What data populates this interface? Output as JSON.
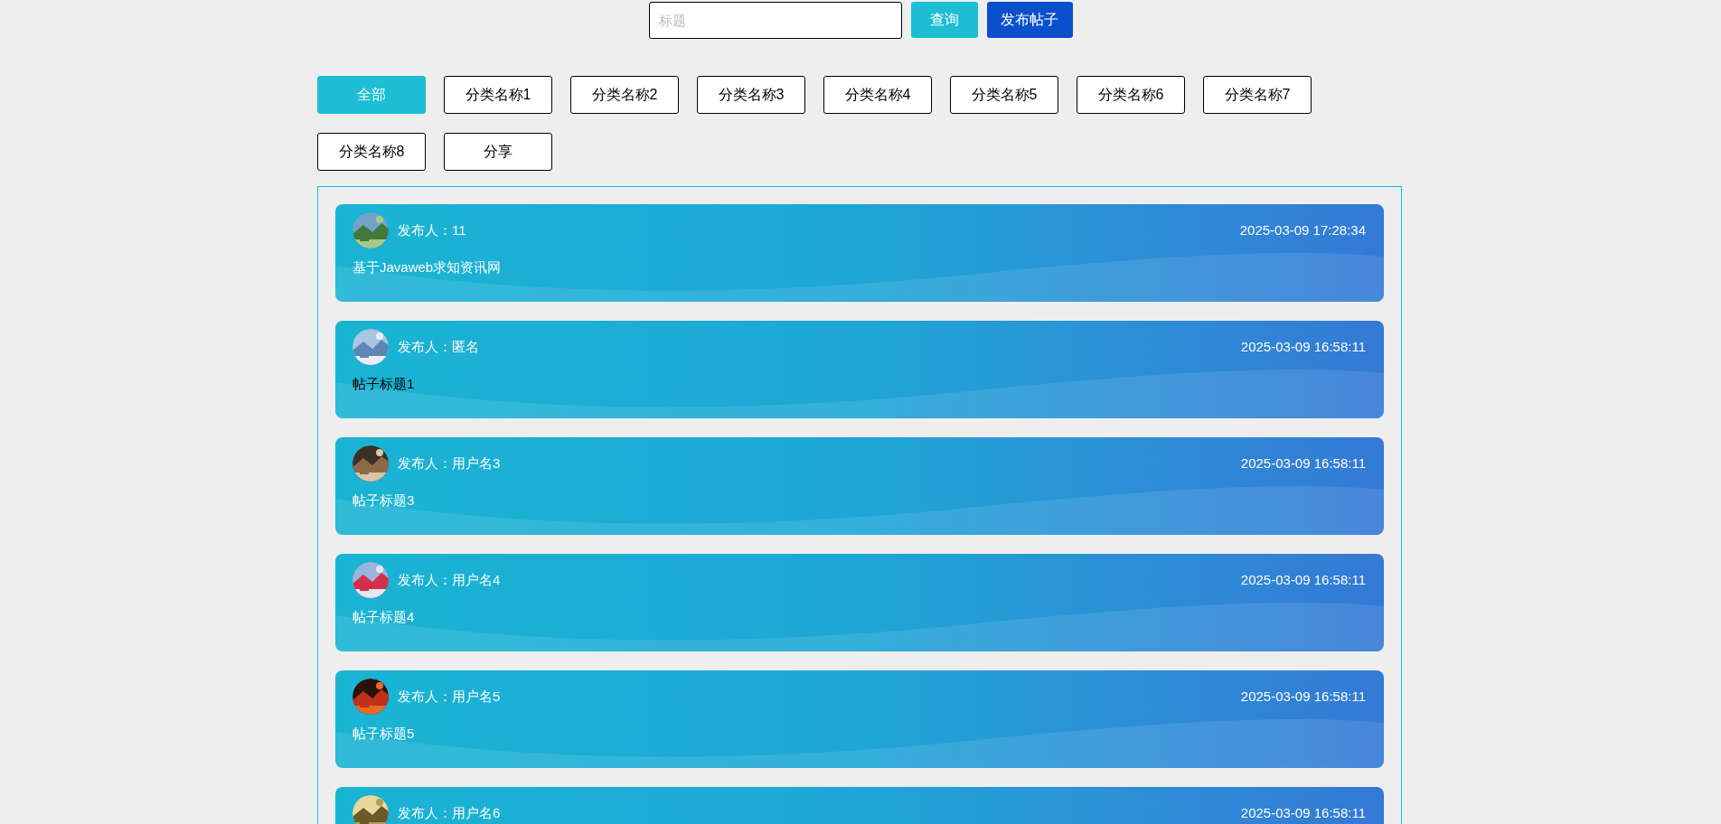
{
  "search": {
    "placeholder": "标题",
    "query_button": "查询",
    "publish_button": "发布帖子"
  },
  "categories": [
    {
      "label": "全部",
      "selected": true
    },
    {
      "label": "分类名称1",
      "selected": false
    },
    {
      "label": "分类名称2",
      "selected": false
    },
    {
      "label": "分类名称3",
      "selected": false
    },
    {
      "label": "分类名称4",
      "selected": false
    },
    {
      "label": "分类名称5",
      "selected": false
    },
    {
      "label": "分类名称6",
      "selected": false
    },
    {
      "label": "分类名称7",
      "selected": false
    },
    {
      "label": "分类名称8",
      "selected": false
    },
    {
      "label": "分享",
      "selected": false
    }
  ],
  "posts": [
    {
      "author": "发布人：11",
      "time": "2025-03-09 17:28:34",
      "title": "基于Javaweb求知资讯网",
      "hovered": false
    },
    {
      "author": "发布人：匿名",
      "time": "2025-03-09 16:58:11",
      "title": "帖子标题1",
      "hovered": true
    },
    {
      "author": "发布人：用户名3",
      "time": "2025-03-09 16:58:11",
      "title": "帖子标题3",
      "hovered": false
    },
    {
      "author": "发布人：用户名4",
      "time": "2025-03-09 16:58:11",
      "title": "帖子标题4",
      "hovered": false
    },
    {
      "author": "发布人：用户名5",
      "time": "2025-03-09 16:58:11",
      "title": "帖子标题5",
      "hovered": false
    },
    {
      "author": "发布人：用户名6",
      "time": "2025-03-09 16:58:11"
    }
  ]
}
